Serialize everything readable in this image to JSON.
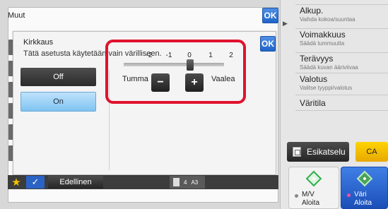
{
  "back_dialog": {
    "title": "Muut",
    "ok_label": "OK"
  },
  "right_panel": {
    "items": [
      {
        "title": "Alkup.",
        "sub": "Vaihda kokoa/suuntaa"
      },
      {
        "title": "Voimakkuus",
        "sub": "Säädä tummuutta"
      },
      {
        "title": "Terävyys",
        "sub": "Säädä kuvan ääriviivaa"
      },
      {
        "title": "Valotus",
        "sub": "Valitse tyyppi/valotus"
      },
      {
        "title": "Väritila",
        "sub": ""
      }
    ],
    "preview_label": "Esikatselu",
    "ca_label": "CA",
    "mono_start": {
      "line1": "M/V",
      "line2": "Aloita"
    },
    "color_start": {
      "line1": "Väri",
      "line2": "Aloita"
    }
  },
  "front_dialog": {
    "title": "Kirkkaus",
    "description": "Tätä asetusta käytetään vain värilliseen.",
    "ok_label": "OK",
    "options": {
      "off": "Off",
      "on": "On",
      "selected": "On"
    },
    "slider": {
      "ticks": [
        "-2",
        "-1",
        "0",
        "1",
        "2"
      ],
      "value": 0,
      "min": -2,
      "max": 2,
      "left_label": "Tumma",
      "right_label": "Vaalea",
      "minus_label": "−",
      "plus_label": "+"
    }
  },
  "bottom_bar": {
    "star_icon": "★",
    "check_icon": "✓",
    "prev_label": "Edellinen",
    "count": "4",
    "paper_size": "A3"
  }
}
